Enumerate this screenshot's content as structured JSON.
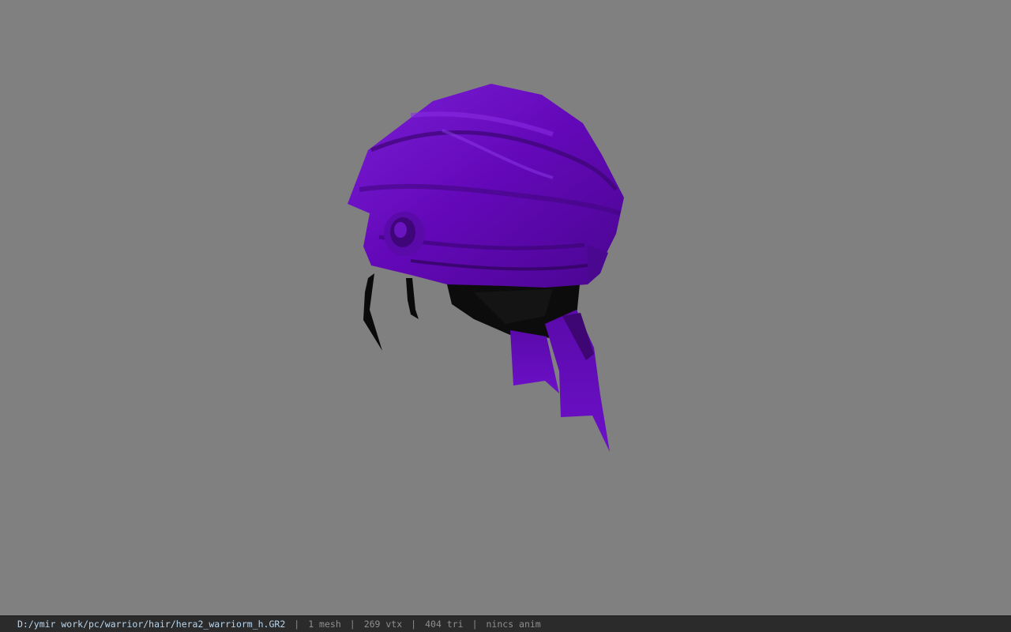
{
  "viewer": {
    "background_color": "#808080",
    "model": {
      "name": "purple-bandana-hair-mesh",
      "primary_color": "#6a0ec0",
      "shadow_color": "#2a0550"
    }
  },
  "statusbar": {
    "file_path": "D:/ymir work/pc/warrior/hair/hera2_warriorm_h.GR2",
    "separator": "|",
    "mesh_count": "1 mesh",
    "vertex_count": "269 vtx",
    "triangle_count": "404 tri",
    "anim_status": "nincs anim"
  }
}
